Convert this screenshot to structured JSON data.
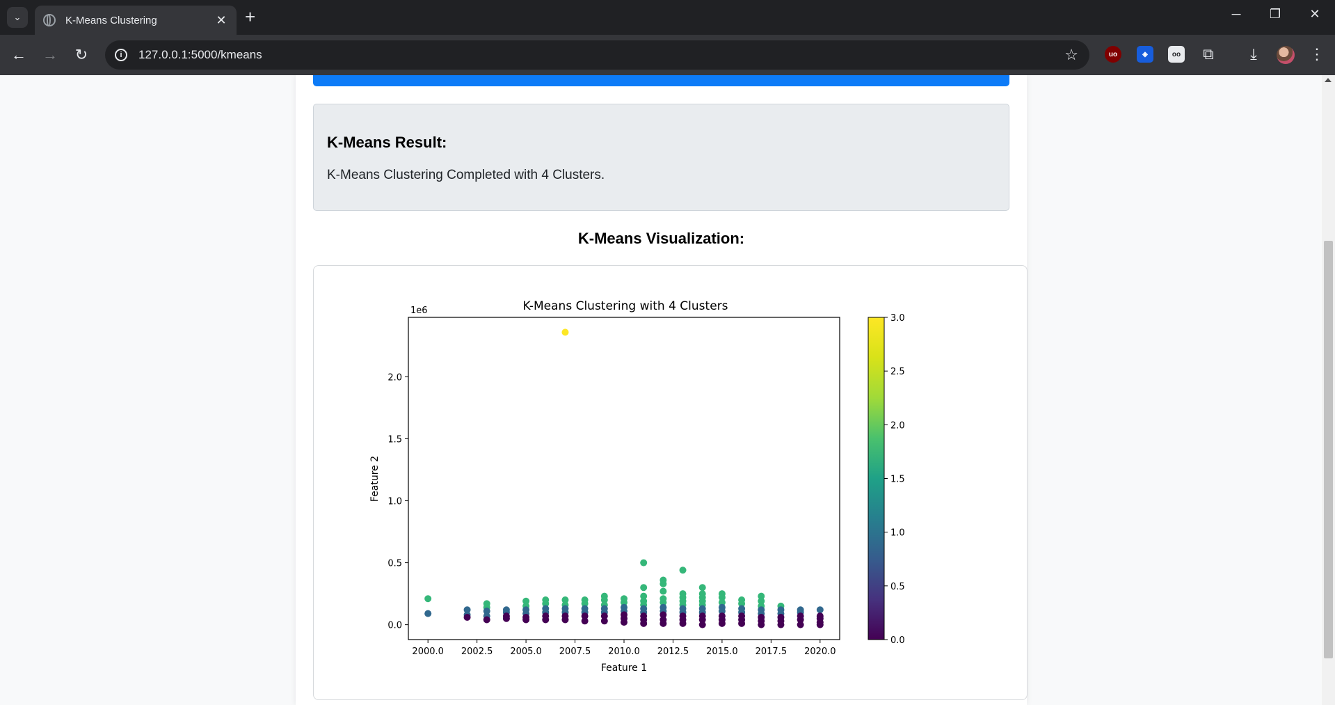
{
  "browser": {
    "tab_title": "K-Means Clustering",
    "url": "127.0.0.1:5000/kmeans",
    "extensions": [
      "ublock-origin-icon",
      "bitwarden-icon",
      "reader-glasses-icon",
      "extensions-puzzle-icon"
    ],
    "window_controls": [
      "minimize-icon",
      "restore-icon",
      "close-icon"
    ]
  },
  "page": {
    "result_heading": "K-Means Result:",
    "result_text": "K-Means Clustering Completed with 4 Clusters.",
    "visualization_heading": "K-Means Visualization:"
  },
  "chart_data": {
    "type": "scatter",
    "title": "K-Means Clustering with 4 Clusters",
    "xlabel": "Feature 1",
    "ylabel": "Feature 2",
    "y_offset_label": "1e6",
    "xlim": [
      1999,
      2021
    ],
    "ylim": [
      -0.12,
      2.48
    ],
    "x_ticks": [
      "2000.0",
      "2002.5",
      "2005.0",
      "2007.5",
      "2010.0",
      "2012.5",
      "2015.0",
      "2017.5",
      "2020.0"
    ],
    "y_ticks": [
      "0.0",
      "0.5",
      "1.0",
      "1.5",
      "2.0"
    ],
    "colorbar": {
      "min": 0.0,
      "max": 3.0,
      "ticks": [
        "0.0",
        "0.5",
        "1.0",
        "1.5",
        "2.0",
        "2.5",
        "3.0"
      ],
      "colormap": "viridis"
    },
    "cluster_colors": [
      "#440154",
      "#31688e",
      "#35b779",
      "#fde725"
    ],
    "points": [
      {
        "x": 2000,
        "y": 0.21,
        "c": 2
      },
      {
        "x": 2000,
        "y": 0.09,
        "c": 1
      },
      {
        "x": 2002,
        "y": 0.12,
        "c": 1
      },
      {
        "x": 2002,
        "y": 0.08,
        "c": 1
      },
      {
        "x": 2002,
        "y": 0.06,
        "c": 0
      },
      {
        "x": 2003,
        "y": 0.17,
        "c": 2
      },
      {
        "x": 2003,
        "y": 0.14,
        "c": 2
      },
      {
        "x": 2003,
        "y": 0.11,
        "c": 1
      },
      {
        "x": 2003,
        "y": 0.07,
        "c": 1
      },
      {
        "x": 2003,
        "y": 0.04,
        "c": 0
      },
      {
        "x": 2004,
        "y": 0.12,
        "c": 1
      },
      {
        "x": 2004,
        "y": 0.1,
        "c": 1
      },
      {
        "x": 2004,
        "y": 0.07,
        "c": 0
      },
      {
        "x": 2004,
        "y": 0.05,
        "c": 0
      },
      {
        "x": 2005,
        "y": 0.19,
        "c": 2
      },
      {
        "x": 2005,
        "y": 0.15,
        "c": 2
      },
      {
        "x": 2005,
        "y": 0.12,
        "c": 1
      },
      {
        "x": 2005,
        "y": 0.09,
        "c": 1
      },
      {
        "x": 2005,
        "y": 0.06,
        "c": 0
      },
      {
        "x": 2005,
        "y": 0.04,
        "c": 0
      },
      {
        "x": 2006,
        "y": 0.2,
        "c": 2
      },
      {
        "x": 2006,
        "y": 0.17,
        "c": 2
      },
      {
        "x": 2006,
        "y": 0.13,
        "c": 1
      },
      {
        "x": 2006,
        "y": 0.1,
        "c": 1
      },
      {
        "x": 2006,
        "y": 0.07,
        "c": 0
      },
      {
        "x": 2006,
        "y": 0.04,
        "c": 0
      },
      {
        "x": 2007,
        "y": 2.36,
        "c": 3
      },
      {
        "x": 2007,
        "y": 0.2,
        "c": 2
      },
      {
        "x": 2007,
        "y": 0.16,
        "c": 2
      },
      {
        "x": 2007,
        "y": 0.13,
        "c": 1
      },
      {
        "x": 2007,
        "y": 0.1,
        "c": 1
      },
      {
        "x": 2007,
        "y": 0.07,
        "c": 0
      },
      {
        "x": 2007,
        "y": 0.04,
        "c": 0
      },
      {
        "x": 2008,
        "y": 0.2,
        "c": 2
      },
      {
        "x": 2008,
        "y": 0.17,
        "c": 2
      },
      {
        "x": 2008,
        "y": 0.13,
        "c": 1
      },
      {
        "x": 2008,
        "y": 0.1,
        "c": 1
      },
      {
        "x": 2008,
        "y": 0.07,
        "c": 0
      },
      {
        "x": 2008,
        "y": 0.03,
        "c": 0
      },
      {
        "x": 2009,
        "y": 0.23,
        "c": 2
      },
      {
        "x": 2009,
        "y": 0.2,
        "c": 2
      },
      {
        "x": 2009,
        "y": 0.16,
        "c": 2
      },
      {
        "x": 2009,
        "y": 0.13,
        "c": 1
      },
      {
        "x": 2009,
        "y": 0.1,
        "c": 1
      },
      {
        "x": 2009,
        "y": 0.07,
        "c": 0
      },
      {
        "x": 2009,
        "y": 0.03,
        "c": 0
      },
      {
        "x": 2010,
        "y": 0.21,
        "c": 2
      },
      {
        "x": 2010,
        "y": 0.18,
        "c": 2
      },
      {
        "x": 2010,
        "y": 0.14,
        "c": 1
      },
      {
        "x": 2010,
        "y": 0.11,
        "c": 1
      },
      {
        "x": 2010,
        "y": 0.08,
        "c": 0
      },
      {
        "x": 2010,
        "y": 0.05,
        "c": 0
      },
      {
        "x": 2010,
        "y": 0.02,
        "c": 0
      },
      {
        "x": 2011,
        "y": 0.5,
        "c": 2
      },
      {
        "x": 2011,
        "y": 0.3,
        "c": 2
      },
      {
        "x": 2011,
        "y": 0.23,
        "c": 2
      },
      {
        "x": 2011,
        "y": 0.19,
        "c": 2
      },
      {
        "x": 2011,
        "y": 0.16,
        "c": 2
      },
      {
        "x": 2011,
        "y": 0.13,
        "c": 1
      },
      {
        "x": 2011,
        "y": 0.1,
        "c": 1
      },
      {
        "x": 2011,
        "y": 0.07,
        "c": 0
      },
      {
        "x": 2011,
        "y": 0.04,
        "c": 0
      },
      {
        "x": 2011,
        "y": 0.01,
        "c": 0
      },
      {
        "x": 2012,
        "y": 0.36,
        "c": 2
      },
      {
        "x": 2012,
        "y": 0.33,
        "c": 2
      },
      {
        "x": 2012,
        "y": 0.27,
        "c": 2
      },
      {
        "x": 2012,
        "y": 0.21,
        "c": 2
      },
      {
        "x": 2012,
        "y": 0.18,
        "c": 2
      },
      {
        "x": 2012,
        "y": 0.14,
        "c": 1
      },
      {
        "x": 2012,
        "y": 0.11,
        "c": 1
      },
      {
        "x": 2012,
        "y": 0.08,
        "c": 0
      },
      {
        "x": 2012,
        "y": 0.04,
        "c": 0
      },
      {
        "x": 2012,
        "y": 0.01,
        "c": 0
      },
      {
        "x": 2013,
        "y": 0.44,
        "c": 2
      },
      {
        "x": 2013,
        "y": 0.25,
        "c": 2
      },
      {
        "x": 2013,
        "y": 0.22,
        "c": 2
      },
      {
        "x": 2013,
        "y": 0.19,
        "c": 2
      },
      {
        "x": 2013,
        "y": 0.16,
        "c": 2
      },
      {
        "x": 2013,
        "y": 0.13,
        "c": 1
      },
      {
        "x": 2013,
        "y": 0.1,
        "c": 1
      },
      {
        "x": 2013,
        "y": 0.07,
        "c": 0
      },
      {
        "x": 2013,
        "y": 0.04,
        "c": 0
      },
      {
        "x": 2013,
        "y": 0.01,
        "c": 0
      },
      {
        "x": 2014,
        "y": 0.3,
        "c": 2
      },
      {
        "x": 2014,
        "y": 0.25,
        "c": 2
      },
      {
        "x": 2014,
        "y": 0.22,
        "c": 2
      },
      {
        "x": 2014,
        "y": 0.19,
        "c": 2
      },
      {
        "x": 2014,
        "y": 0.16,
        "c": 2
      },
      {
        "x": 2014,
        "y": 0.13,
        "c": 1
      },
      {
        "x": 2014,
        "y": 0.1,
        "c": 1
      },
      {
        "x": 2014,
        "y": 0.07,
        "c": 0
      },
      {
        "x": 2014,
        "y": 0.04,
        "c": 0
      },
      {
        "x": 2014,
        "y": 0.0,
        "c": 0
      },
      {
        "x": 2015,
        "y": 0.25,
        "c": 2
      },
      {
        "x": 2015,
        "y": 0.22,
        "c": 2
      },
      {
        "x": 2015,
        "y": 0.18,
        "c": 2
      },
      {
        "x": 2015,
        "y": 0.14,
        "c": 1
      },
      {
        "x": 2015,
        "y": 0.11,
        "c": 1
      },
      {
        "x": 2015,
        "y": 0.07,
        "c": 0
      },
      {
        "x": 2015,
        "y": 0.04,
        "c": 0
      },
      {
        "x": 2015,
        "y": 0.01,
        "c": 0
      },
      {
        "x": 2016,
        "y": 0.2,
        "c": 2
      },
      {
        "x": 2016,
        "y": 0.17,
        "c": 2
      },
      {
        "x": 2016,
        "y": 0.13,
        "c": 1
      },
      {
        "x": 2016,
        "y": 0.1,
        "c": 1
      },
      {
        "x": 2016,
        "y": 0.07,
        "c": 0
      },
      {
        "x": 2016,
        "y": 0.04,
        "c": 0
      },
      {
        "x": 2016,
        "y": 0.01,
        "c": 0
      },
      {
        "x": 2017,
        "y": 0.23,
        "c": 2
      },
      {
        "x": 2017,
        "y": 0.19,
        "c": 2
      },
      {
        "x": 2017,
        "y": 0.15,
        "c": 2
      },
      {
        "x": 2017,
        "y": 0.12,
        "c": 1
      },
      {
        "x": 2017,
        "y": 0.09,
        "c": 1
      },
      {
        "x": 2017,
        "y": 0.06,
        "c": 0
      },
      {
        "x": 2017,
        "y": 0.03,
        "c": 0
      },
      {
        "x": 2017,
        "y": 0.0,
        "c": 0
      },
      {
        "x": 2018,
        "y": 0.15,
        "c": 2
      },
      {
        "x": 2018,
        "y": 0.12,
        "c": 1
      },
      {
        "x": 2018,
        "y": 0.09,
        "c": 1
      },
      {
        "x": 2018,
        "y": 0.06,
        "c": 0
      },
      {
        "x": 2018,
        "y": 0.03,
        "c": 0
      },
      {
        "x": 2018,
        "y": 0.0,
        "c": 0
      },
      {
        "x": 2019,
        "y": 0.12,
        "c": 1
      },
      {
        "x": 2019,
        "y": 0.1,
        "c": 1
      },
      {
        "x": 2019,
        "y": 0.07,
        "c": 0
      },
      {
        "x": 2019,
        "y": 0.04,
        "c": 0
      },
      {
        "x": 2019,
        "y": 0.0,
        "c": 0
      },
      {
        "x": 2020,
        "y": 0.12,
        "c": 1
      },
      {
        "x": 2020,
        "y": 0.07,
        "c": 0
      },
      {
        "x": 2020,
        "y": 0.05,
        "c": 0
      },
      {
        "x": 2020,
        "y": 0.02,
        "c": 0
      },
      {
        "x": 2020,
        "y": 0.0,
        "c": 0
      }
    ]
  }
}
